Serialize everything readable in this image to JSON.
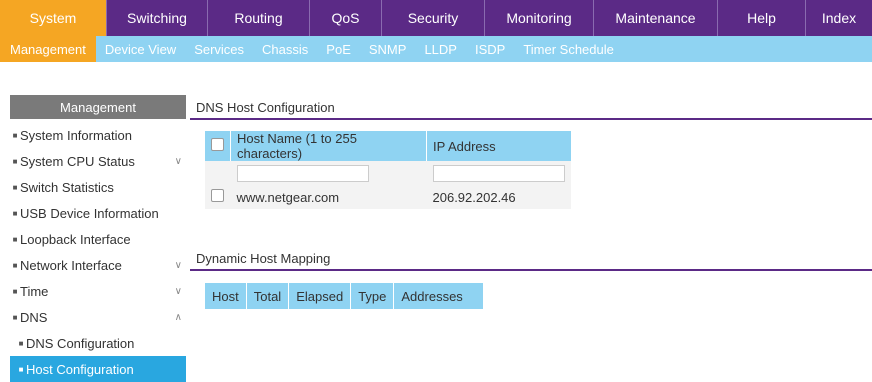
{
  "topnav": {
    "tabs": [
      {
        "label": "System",
        "active": true
      },
      {
        "label": "Switching"
      },
      {
        "label": "Routing"
      },
      {
        "label": "QoS"
      },
      {
        "label": "Security"
      },
      {
        "label": "Monitoring"
      },
      {
        "label": "Maintenance"
      },
      {
        "label": "Help"
      },
      {
        "label": "Index"
      }
    ]
  },
  "subnav": {
    "items": [
      {
        "label": "Management",
        "active": true
      },
      {
        "label": "Device View"
      },
      {
        "label": "Services"
      },
      {
        "label": "Chassis"
      },
      {
        "label": "PoE"
      },
      {
        "label": "SNMP"
      },
      {
        "label": "LLDP"
      },
      {
        "label": "ISDP"
      },
      {
        "label": "Timer Schedule"
      }
    ]
  },
  "sidebar": {
    "title": "Management",
    "items": [
      {
        "label": "System Information"
      },
      {
        "label": "System CPU Status",
        "chevron": "down"
      },
      {
        "label": "Switch Statistics"
      },
      {
        "label": "USB Device Information"
      },
      {
        "label": "Loopback Interface"
      },
      {
        "label": "Network Interface",
        "chevron": "down"
      },
      {
        "label": "Time",
        "chevron": "down"
      },
      {
        "label": "DNS",
        "chevron": "up"
      },
      {
        "label": "DNS Configuration",
        "sub": true
      },
      {
        "label": "Host Configuration",
        "sub": true,
        "active": true
      }
    ]
  },
  "dns_host": {
    "title": "DNS Host Configuration",
    "columns": [
      "Host Name (1 to 255 characters)",
      "IP Address"
    ],
    "rows": [
      {
        "host": "www.netgear.com",
        "ip": "206.92.202.46"
      }
    ]
  },
  "dynamic": {
    "title": "Dynamic Host Mapping",
    "columns": [
      "Host",
      "Total",
      "Elapsed",
      "Type",
      "Addresses"
    ]
  },
  "colors": {
    "nav_purple": "#5b2a86",
    "accent_orange": "#f5a623",
    "light_blue": "#8fd3f2",
    "active_blue": "#29a7e0"
  }
}
